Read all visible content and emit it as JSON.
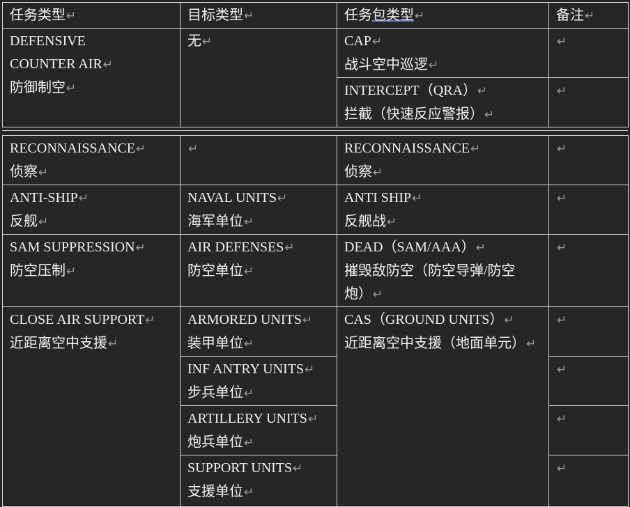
{
  "paragraph_mark": "↵",
  "header": {
    "col1": "任务类型",
    "col2": "目标类型",
    "col3_before": "任务",
    "col3_link": "包类型",
    "col4": "备注"
  },
  "defensive": {
    "task_en_1": "DEFENSIVE",
    "task_en_2": "COUNTER AIR",
    "task_cn": "防御制空",
    "target": "无",
    "pkg1_en": "CAP",
    "pkg1_cn": "战斗空中巡逻",
    "pkg2_en": "INTERCEPT（QRA）",
    "pkg2_cn": "拦截（快速反应警报）"
  },
  "recon": {
    "task_en": "RECONNAISSANCE",
    "task_cn": "侦察",
    "pkg_en": "RECONNAISSANCE",
    "pkg_cn": "侦察"
  },
  "antiship": {
    "task_en": "ANTI-SHIP",
    "task_cn": "反舰",
    "target_en": "NAVAL UNITS",
    "target_cn": "海军单位",
    "pkg_en": "ANTI SHIP",
    "pkg_cn": "反舰战"
  },
  "sam": {
    "task_en": "SAM SUPPRESSION",
    "task_cn": "防空压制",
    "target_en": "AIR DEFENSES",
    "target_cn": "防空单位",
    "pkg_en": "DEAD（SAM/AAA）",
    "pkg_cn_1": "摧毁敌防空（防空导弹/防空",
    "pkg_cn_2": "炮）"
  },
  "cas": {
    "task_en": "CLOSE AIR SUPPORT",
    "task_cn": "近距离空中支援",
    "pkg_en": "CAS（GROUND UNITS）",
    "pkg_cn": "近距离空中支援（地面单元）",
    "targets": [
      {
        "en": "ARMORED UNITS",
        "cn": "装甲单位"
      },
      {
        "en": "INF ANTRY UNITS",
        "cn": "步兵单位"
      },
      {
        "en": "ARTILLERY UNITS",
        "cn": "炮兵单位"
      },
      {
        "en": "SUPPORT UNITS",
        "cn": "支援单位"
      }
    ]
  }
}
